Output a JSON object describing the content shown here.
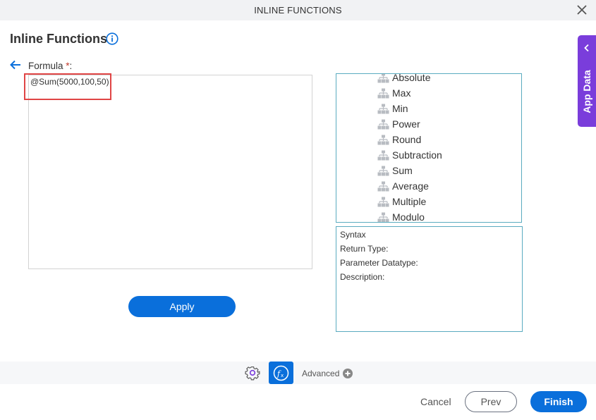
{
  "window": {
    "title": "INLINE FUNCTIONS"
  },
  "header": {
    "title": "Inline Functions"
  },
  "formula": {
    "label": "Formula",
    "required_marker": "*",
    "label_suffix": ":",
    "value": "@Sum(5000,100,50)"
  },
  "apply_label": "Apply",
  "functions": [
    {
      "label": "Absolute"
    },
    {
      "label": "Max"
    },
    {
      "label": "Min"
    },
    {
      "label": "Power"
    },
    {
      "label": "Round"
    },
    {
      "label": "Subtraction"
    },
    {
      "label": "Sum"
    },
    {
      "label": "Average"
    },
    {
      "label": "Multiple"
    },
    {
      "label": "Modulo"
    }
  ],
  "info": {
    "syntax": "Syntax",
    "return_type": "Return Type:",
    "parameter_datatype": "Parameter Datatype:",
    "description": "Description:"
  },
  "side_panel": {
    "label": "App Data"
  },
  "toolbar": {
    "advanced_label": "Advanced"
  },
  "footer": {
    "cancel_label": "Cancel",
    "prev_label": "Prev",
    "finish_label": "Finish"
  },
  "colors": {
    "primary": "#0a6fdb",
    "side_tab": "#7a3ddb",
    "highlight": "#e04545",
    "panel_border": "#5aabc0"
  }
}
